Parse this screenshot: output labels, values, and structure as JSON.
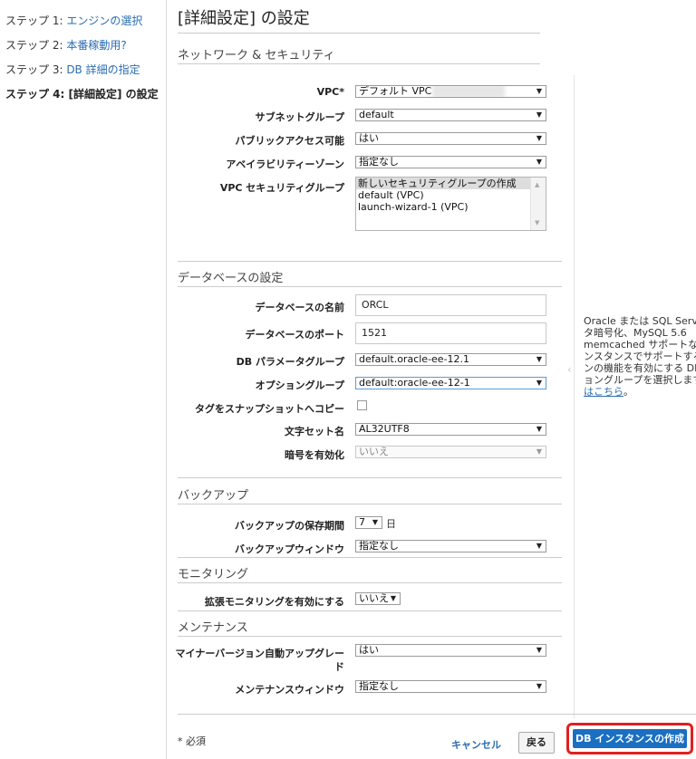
{
  "steps": [
    {
      "prefix": "ステップ 1: ",
      "link": "エンジンの選択"
    },
    {
      "prefix": "ステップ 2: ",
      "link": "本番稼動用?"
    },
    {
      "prefix": "ステップ 3: ",
      "link": "DB 詳細の指定"
    },
    {
      "current": "ステップ 4: [詳細設定] の設定"
    }
  ],
  "page_title": "[詳細設定] の設定",
  "network": {
    "heading": "ネットワーク & セキュリティ",
    "vpc_label": "VPC*",
    "vpc_value": "デフォルト VPC",
    "subnet_label": "サブネットグループ",
    "subnet_value": "default",
    "public_label": "パブリックアクセス可能",
    "public_value": "はい",
    "az_label": "アベイラビリティーゾーン",
    "az_value": "指定なし",
    "sg_label": "VPC セキュリティグループ",
    "sg_options": [
      "新しいセキュリティグループの作成",
      "default (VPC)",
      "launch-wizard-1 (VPC)"
    ]
  },
  "database": {
    "heading": "データベースの設定",
    "name_label": "データベースの名前",
    "name_value": "ORCL",
    "port_label": "データベースのポート",
    "port_value": "1521",
    "param_label": "DB パラメータグループ",
    "param_value": "default.oracle-ee-12.1",
    "option_label": "オプショングループ",
    "option_value": "default:oracle-ee-12-1",
    "copy_tags_label": "タグをスナップショットへコピー",
    "charset_label": "文字セット名",
    "charset_value": "AL32UTF8",
    "encrypt_label": "暗号を有効化",
    "encrypt_value": "いいえ"
  },
  "backup": {
    "heading": "バックアップ",
    "retention_label": "バックアップの保存期間",
    "retention_value": "7",
    "retention_unit": "日",
    "window_label": "バックアップウィンドウ",
    "window_value": "指定なし"
  },
  "monitoring": {
    "heading": "モニタリング",
    "enhanced_label": "拡張モニタリングを有効にする",
    "enhanced_value": "いいえ"
  },
  "maintenance": {
    "heading": "メンテナンス",
    "minor_label_1": "マイナーバージョン自動アップグレー",
    "minor_label_2": "ド",
    "minor_value": "はい",
    "window_label": "メンテナンスウィンドウ",
    "window_value": "指定なし"
  },
  "help": {
    "lines": [
      "Oracle または SQL Serv",
      "タ暗号化、MySQL 5.6",
      "memcached サポートなど",
      "ンスタンスでサポートする",
      "ンの機能を有効にする DB",
      "ョングループを選択します"
    ],
    "link": "はこちら",
    "link_suffix": "。"
  },
  "footer": {
    "required_note": "* 必須",
    "cancel": "キャンセル",
    "back": "戻る",
    "create": "DB インスタンスの作成"
  },
  "colors": {
    "link": "#2a6db1",
    "primary": "#1a6fc2",
    "highlight_border": "#e02020"
  }
}
